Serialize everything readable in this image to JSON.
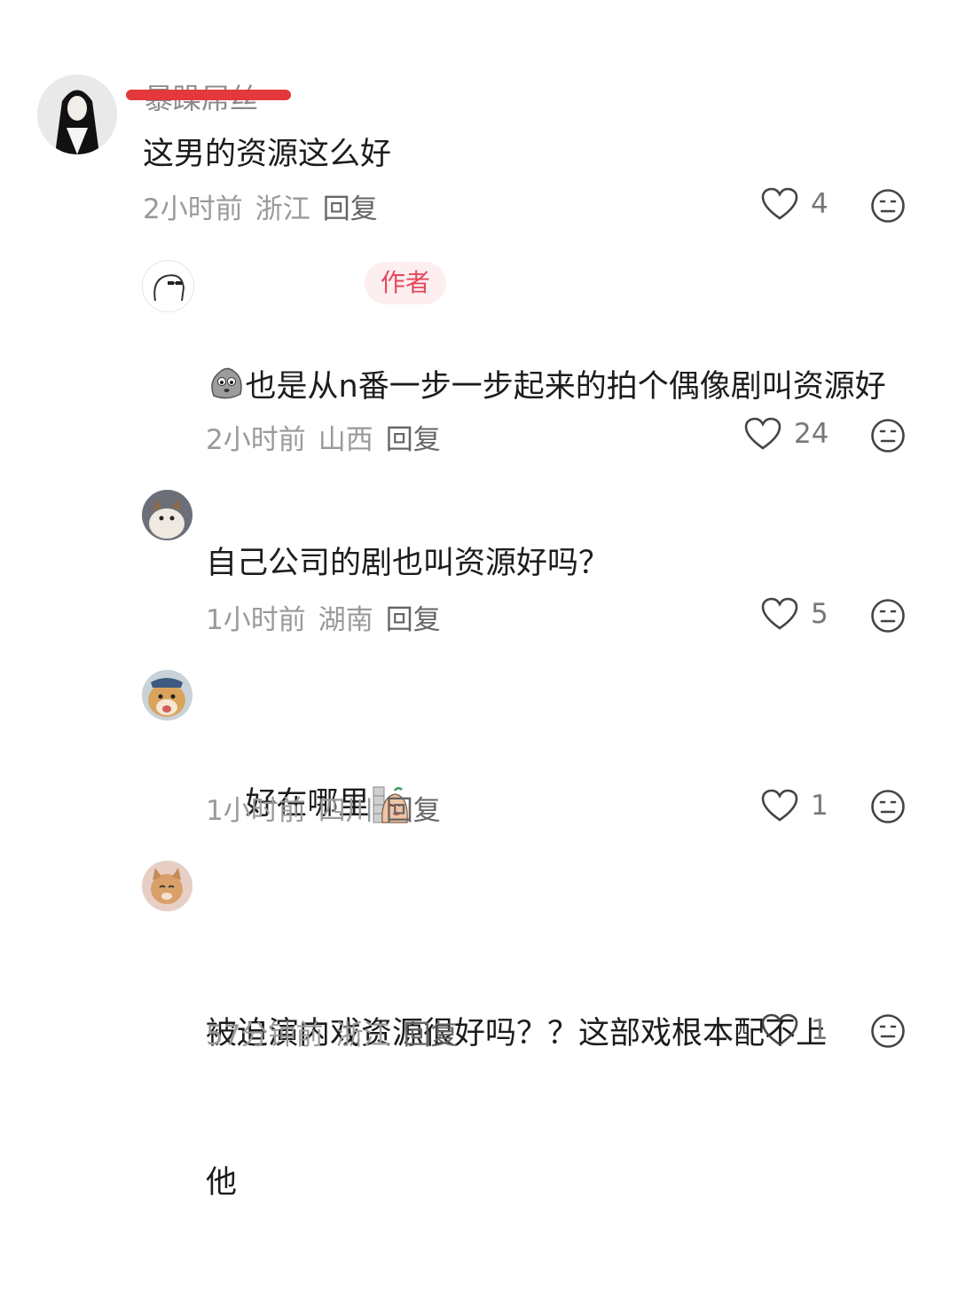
{
  "comments": [
    {
      "username": "暴躁屌丝",
      "text": "这男的资源这么好",
      "time": "2小时前",
      "location": "浙江",
      "reply_label": "回复",
      "likes": "4"
    },
    {
      "username": "",
      "author_badge": "作者",
      "text_line1": "也是从n番一步一步起来的拍个偶像剧叫资源好",
      "emoji": "sad-rock-face-emoji",
      "time": "2小时前",
      "location": "山西",
      "reply_label": "回复",
      "likes": "24"
    },
    {
      "username": "",
      "text": "自己公司的剧也叫资源好吗？",
      "time": "1小时前",
      "location": "湖南",
      "reply_label": "回复",
      "likes": "5"
    },
    {
      "username": "",
      "text": "好在哪里",
      "emoji": "peeking-wall-emoji",
      "time": "1小时前",
      "location": "四川",
      "reply_label": "回复",
      "likes": "1"
    },
    {
      "username": "",
      "text_line1": "被迫演内戏资源很好吗？？这部戏根本配不上",
      "text_line2": "他",
      "time": "57分钟前",
      "location": "浙江",
      "reply_label": "回复",
      "likes": "1"
    }
  ],
  "colors": {
    "strike": "#e4393c",
    "badge_text": "#e8485a",
    "badge_bg": "#fdeef0"
  }
}
